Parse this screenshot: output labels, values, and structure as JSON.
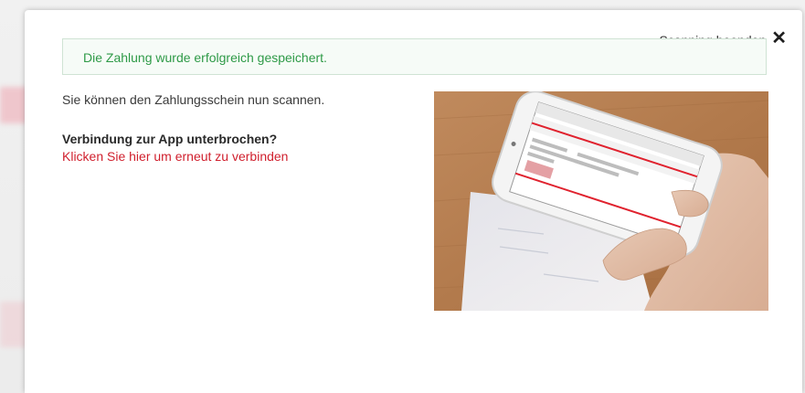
{
  "modal": {
    "close_label": "Scanning beenden",
    "close_icon": "close-icon"
  },
  "alert": {
    "message": "Die Zahlung wurde erfolgreich gespeichert.",
    "color": "#2e9a47"
  },
  "content": {
    "intro": "Sie können den Zahlungsschein nun scannen.",
    "reconnect_question": "Verbindung zur App unterbrochen?",
    "reconnect_link": "Klicken Sie hier um erneut zu verbinden",
    "link_color": "#d0202e"
  },
  "illustration": {
    "icon": "phone-scanning-image"
  }
}
